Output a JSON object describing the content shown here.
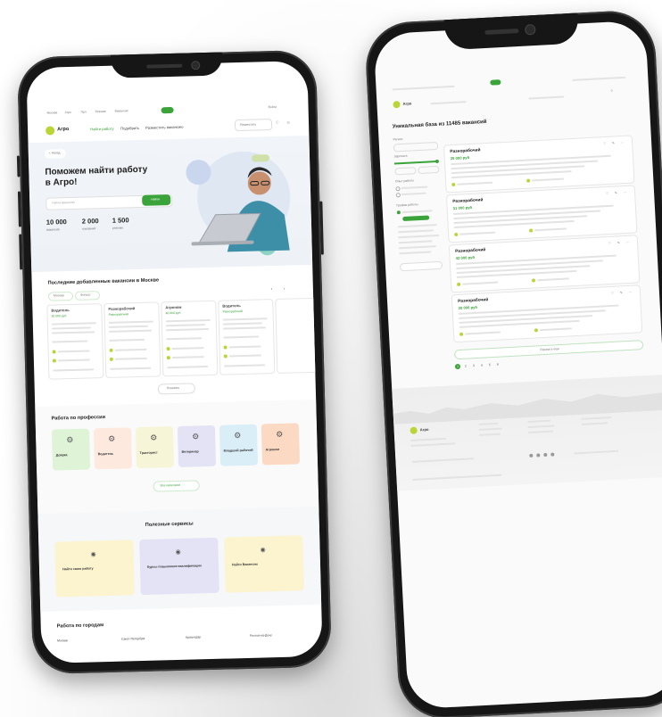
{
  "left": {
    "nav": [
      "Москва",
      "Агро",
      "Про",
      "Резюме",
      "Вакансии",
      "Войти"
    ],
    "logo": "Агро",
    "menu": [
      "Найти работу",
      "Подобрать",
      "Разместить вакансию"
    ],
    "post_button": "Разместить",
    "back": "< Назад",
    "hero_title": "Поможем найти работу в Агро!",
    "search_placeholder": "Найти вакансию",
    "search_button": "Найти",
    "stats": [
      {
        "value": "10 000",
        "label": "вакансий"
      },
      {
        "value": "2 000",
        "label": "компаний"
      },
      {
        "value": "1 500",
        "label": "резюме"
      }
    ],
    "latest_title": "Последние добавленные вакансии в Москве",
    "filters": [
      "Москва",
      "Фильтр"
    ],
    "vacancy_cards": [
      {
        "role": "Водитель",
        "salary": "30 000 руб"
      },
      {
        "role": "Разнорабочий",
        "salary": "Разнорабочий"
      },
      {
        "role": "Агроном",
        "salary": "40 000 руб"
      },
      {
        "role": "Водитель",
        "salary": "Разнорабочий"
      }
    ],
    "show_more": "Показать",
    "professions_title": "Работа по профессии",
    "professions": [
      {
        "label": "Доярка",
        "color": "#dff3d6"
      },
      {
        "label": "Водитель",
        "color": "#fde9de"
      },
      {
        "label": "Тракторист",
        "color": "#f6f5d8"
      },
      {
        "label": "Ветеринар",
        "color": "#e4e3f6"
      },
      {
        "label": "Младший рабочий",
        "color": "#daeef8"
      },
      {
        "label": "Агроном",
        "color": "#fbd9c2"
      }
    ],
    "all_categories": "Все категории",
    "services_title": "Полезные сервисы",
    "services": [
      {
        "label": "Найти свою работу",
        "color": "#fcf3cf"
      },
      {
        "label": "Курсы повышения квалификации",
        "color": "#e4e3f6"
      },
      {
        "label": "Найти Вакансии",
        "color": "#fcf3cf"
      }
    ],
    "cities_title": "Работа по городам",
    "cities": [
      "Москва",
      "Санкт-Петербург",
      "Краснодар",
      "Ростов-на-Дону"
    ]
  },
  "right": {
    "logo": "Агро",
    "heading": "Уникальная база из 11485 вакансий",
    "filter_labels": [
      "Регион",
      "Зарплата",
      "Опыт работы",
      "График работы"
    ],
    "vacancies": [
      {
        "title": "Разнорабочий",
        "salary": "25 000 руб"
      },
      {
        "title": "Разнорабочий",
        "salary": "31 000 руб"
      },
      {
        "title": "Разнорабочий",
        "salary": "42 000 руб"
      },
      {
        "title": "Разнорабочий",
        "salary": "30 000 руб"
      }
    ],
    "show_more": "Показать еще",
    "pages": [
      "1",
      "2",
      "3",
      "4",
      "5",
      "6"
    ],
    "footer_logo": "Агро"
  }
}
